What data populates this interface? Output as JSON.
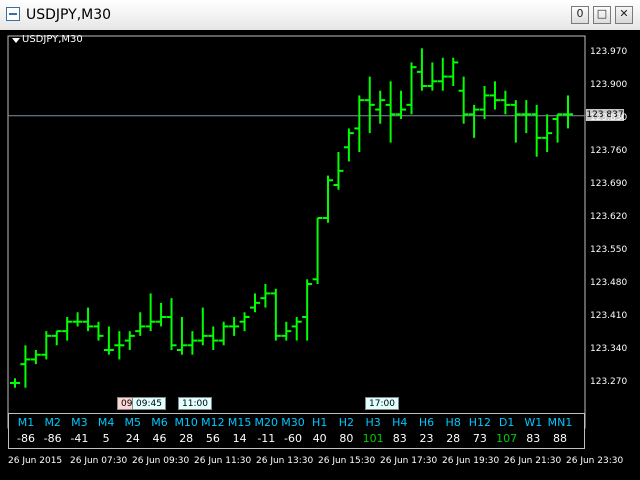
{
  "window": {
    "title": "USDJPY,M30",
    "buttons": {
      "minimize": "0",
      "maximize": "□",
      "close": "✕"
    }
  },
  "chart": {
    "symbol_label": "USDJPY,M30",
    "current_price": "123.837",
    "colors": {
      "bars": "#00ff00",
      "background": "#000000",
      "text": "#ffffff",
      "accent": "#00c8ff"
    }
  },
  "time_tags": [
    "09:",
    "09:45",
    "11:00",
    "17:00"
  ],
  "timeframes": [
    {
      "tf": "M1",
      "value": "-86"
    },
    {
      "tf": "M2",
      "value": "-86"
    },
    {
      "tf": "M3",
      "value": "-41"
    },
    {
      "tf": "M4",
      "value": "5"
    },
    {
      "tf": "M5",
      "value": "24"
    },
    {
      "tf": "M6",
      "value": "46"
    },
    {
      "tf": "M10",
      "value": "28"
    },
    {
      "tf": "M12",
      "value": "56"
    },
    {
      "tf": "M15",
      "value": "14"
    },
    {
      "tf": "M20",
      "value": "-11"
    },
    {
      "tf": "M30",
      "value": "-60"
    },
    {
      "tf": "H1",
      "value": "40"
    },
    {
      "tf": "H2",
      "value": "80"
    },
    {
      "tf": "H3",
      "value": "101"
    },
    {
      "tf": "H4",
      "value": "83"
    },
    {
      "tf": "H6",
      "value": "23"
    },
    {
      "tf": "H8",
      "value": "28"
    },
    {
      "tf": "H12",
      "value": "73"
    },
    {
      "tf": "D1",
      "value": "107"
    },
    {
      "tf": "W1",
      "value": "83"
    },
    {
      "tf": "MN1",
      "value": "88"
    }
  ],
  "x_labels": [
    "26 Jun 2015",
    "26 Jun 07:30",
    "26 Jun 09:30",
    "26 Jun 11:30",
    "26 Jun 13:30",
    "26 Jun 15:30",
    "26 Jun 17:30",
    "26 Jun 19:30",
    "26 Jun 21:30",
    "26 Jun 23:30"
  ],
  "y_labels": [
    "123.970",
    "123.900",
    "123.830",
    "123.760",
    "123.690",
    "123.620",
    "123.550",
    "123.480",
    "123.410",
    "123.340",
    "123.270"
  ],
  "chart_data": {
    "type": "bar",
    "ylim": [
      123.23,
      123.98
    ],
    "bars": [
      {
        "o": 123.27,
        "h": 123.28,
        "l": 123.26,
        "c": 123.27
      },
      {
        "o": 123.31,
        "h": 123.35,
        "l": 123.26,
        "c": 123.32
      },
      {
        "o": 123.32,
        "h": 123.34,
        "l": 123.31,
        "c": 123.33
      },
      {
        "o": 123.33,
        "h": 123.38,
        "l": 123.32,
        "c": 123.37
      },
      {
        "o": 123.37,
        "h": 123.38,
        "l": 123.35,
        "c": 123.38
      },
      {
        "o": 123.38,
        "h": 123.41,
        "l": 123.36,
        "c": 123.4
      },
      {
        "o": 123.4,
        "h": 123.42,
        "l": 123.39,
        "c": 123.4
      },
      {
        "o": 123.4,
        "h": 123.43,
        "l": 123.38,
        "c": 123.39
      },
      {
        "o": 123.39,
        "h": 123.4,
        "l": 123.36,
        "c": 123.37
      },
      {
        "o": 123.34,
        "h": 123.39,
        "l": 123.33,
        "c": 123.34
      },
      {
        "o": 123.35,
        "h": 123.38,
        "l": 123.32,
        "c": 123.35
      },
      {
        "o": 123.36,
        "h": 123.38,
        "l": 123.34,
        "c": 123.37
      },
      {
        "o": 123.38,
        "h": 123.42,
        "l": 123.37,
        "c": 123.39
      },
      {
        "o": 123.39,
        "h": 123.46,
        "l": 123.38,
        "c": 123.4
      },
      {
        "o": 123.4,
        "h": 123.44,
        "l": 123.39,
        "c": 123.41
      },
      {
        "o": 123.41,
        "h": 123.45,
        "l": 123.34,
        "c": 123.35
      },
      {
        "o": 123.34,
        "h": 123.41,
        "l": 123.33,
        "c": 123.35
      },
      {
        "o": 123.35,
        "h": 123.38,
        "l": 123.33,
        "c": 123.36
      },
      {
        "o": 123.36,
        "h": 123.43,
        "l": 123.35,
        "c": 123.37
      },
      {
        "o": 123.37,
        "h": 123.39,
        "l": 123.34,
        "c": 123.36
      },
      {
        "o": 123.36,
        "h": 123.4,
        "l": 123.35,
        "c": 123.39
      },
      {
        "o": 123.39,
        "h": 123.41,
        "l": 123.37,
        "c": 123.39
      },
      {
        "o": 123.4,
        "h": 123.42,
        "l": 123.38,
        "c": 123.41
      },
      {
        "o": 123.43,
        "h": 123.46,
        "l": 123.42,
        "c": 123.44
      },
      {
        "o": 123.45,
        "h": 123.48,
        "l": 123.43,
        "c": 123.46
      },
      {
        "o": 123.46,
        "h": 123.47,
        "l": 123.36,
        "c": 123.37
      },
      {
        "o": 123.37,
        "h": 123.4,
        "l": 123.36,
        "c": 123.38
      },
      {
        "o": 123.39,
        "h": 123.41,
        "l": 123.36,
        "c": 123.4
      },
      {
        "o": 123.41,
        "h": 123.49,
        "l": 123.36,
        "c": 123.48
      },
      {
        "o": 123.49,
        "h": 123.62,
        "l": 123.48,
        "c": 123.62
      },
      {
        "o": 123.62,
        "h": 123.71,
        "l": 123.61,
        "c": 123.7
      },
      {
        "o": 123.69,
        "h": 123.76,
        "l": 123.68,
        "c": 123.72
      },
      {
        "o": 123.77,
        "h": 123.81,
        "l": 123.74,
        "c": 123.8
      },
      {
        "o": 123.81,
        "h": 123.88,
        "l": 123.76,
        "c": 123.87
      },
      {
        "o": 123.87,
        "h": 123.92,
        "l": 123.8,
        "c": 123.86
      },
      {
        "o": 123.85,
        "h": 123.89,
        "l": 123.82,
        "c": 123.87
      },
      {
        "o": 123.86,
        "h": 123.91,
        "l": 123.78,
        "c": 123.84
      },
      {
        "o": 123.84,
        "h": 123.89,
        "l": 123.83,
        "c": 123.85
      },
      {
        "o": 123.86,
        "h": 123.95,
        "l": 123.84,
        "c": 123.94
      },
      {
        "o": 123.93,
        "h": 123.98,
        "l": 123.89,
        "c": 123.9
      },
      {
        "o": 123.9,
        "h": 123.95,
        "l": 123.89,
        "c": 123.91
      },
      {
        "o": 123.91,
        "h": 123.96,
        "l": 123.89,
        "c": 123.92
      },
      {
        "o": 123.92,
        "h": 123.96,
        "l": 123.9,
        "c": 123.95
      },
      {
        "o": 123.89,
        "h": 123.92,
        "l": 123.82,
        "c": 123.84
      },
      {
        "o": 123.84,
        "h": 123.86,
        "l": 123.79,
        "c": 123.85
      },
      {
        "o": 123.85,
        "h": 123.9,
        "l": 123.83,
        "c": 123.88
      },
      {
        "o": 123.88,
        "h": 123.91,
        "l": 123.85,
        "c": 123.87
      },
      {
        "o": 123.87,
        "h": 123.89,
        "l": 123.84,
        "c": 123.86
      },
      {
        "o": 123.86,
        "h": 123.87,
        "l": 123.78,
        "c": 123.84
      },
      {
        "o": 123.84,
        "h": 123.87,
        "l": 123.8,
        "c": 123.84
      },
      {
        "o": 123.84,
        "h": 123.86,
        "l": 123.75,
        "c": 123.79
      },
      {
        "o": 123.79,
        "h": 123.84,
        "l": 123.76,
        "c": 123.8
      },
      {
        "o": 123.83,
        "h": 123.84,
        "l": 123.78,
        "c": 123.84
      },
      {
        "o": 123.84,
        "h": 123.88,
        "l": 123.81,
        "c": 123.84
      }
    ]
  }
}
